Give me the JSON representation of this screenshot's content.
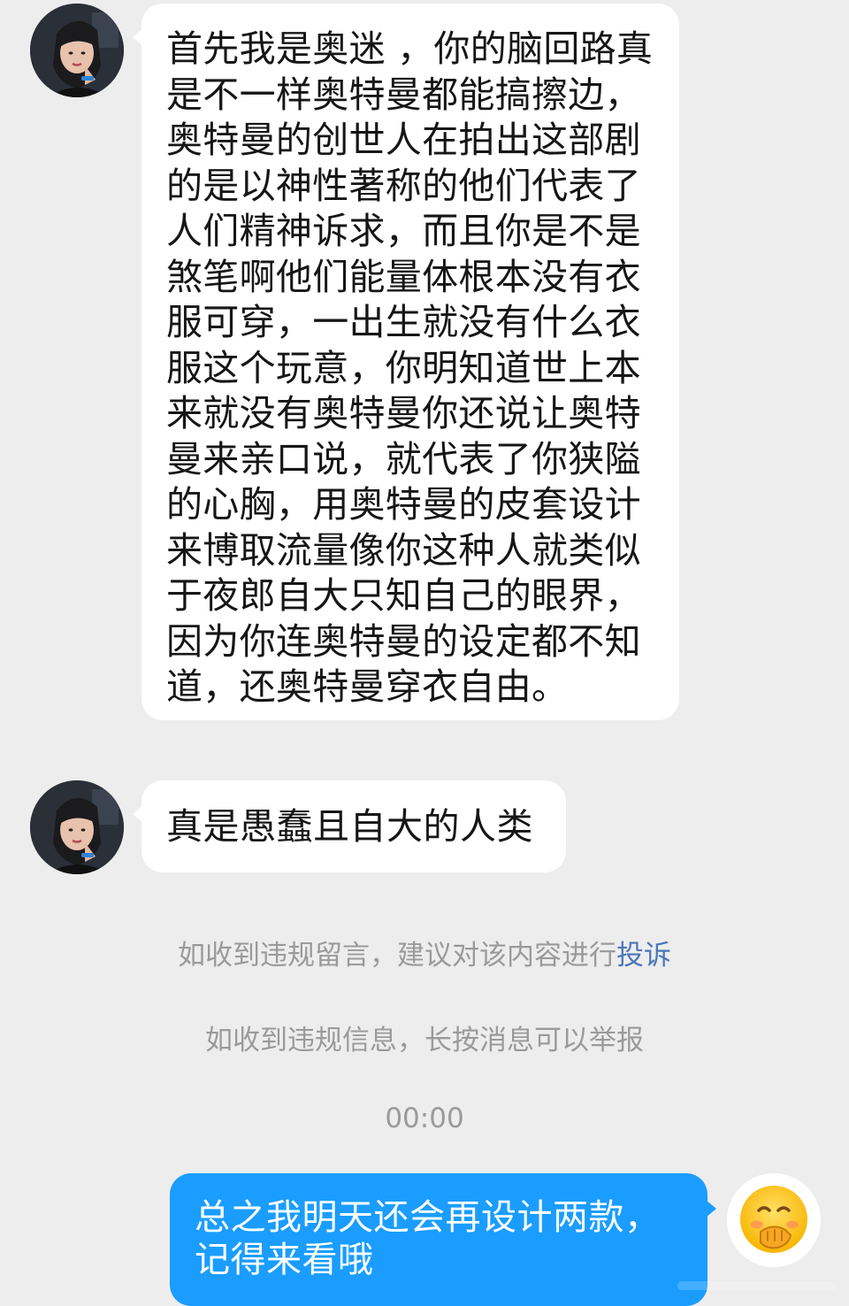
{
  "messages": [
    {
      "sender": "other",
      "text": "首先我是奥迷 ，你的脑回路真是不一样奥特曼都能搞擦边，奥特曼的创世人在拍出这部剧的是以神性著称的他们代表了人们精神诉求，而且你是不是煞笔啊他们能量体根本没有衣服可穿，一出生就没有什么衣服这个玩意，你明知道世上本来就没有奥特曼你还说让奥特曼来亲口说，就代表了你狭隘的心胸，用奥特曼的皮套设计来博取流量像你这种人就类似于夜郎自大只知自己的眼界，因为你连奥特曼的设定都不知道，还奥特曼穿衣自由。"
    },
    {
      "sender": "other",
      "text": "真是愚蠢且自大的人类"
    }
  ],
  "notices": {
    "complaint_prefix": "如收到违规留言，建议对该内容进行",
    "complaint_link": "投诉",
    "report": "如收到违规信息，长按消息可以举报"
  },
  "timestamp": "00:00",
  "outgoing": {
    "text": "总之我明天还会再设计两款，记得来看哦"
  },
  "colors": {
    "background": "#ededed",
    "incoming_bubble": "#ffffff",
    "outgoing_bubble": "#1a9dff",
    "link": "#4a77b8",
    "notice_text": "#9a9a9a"
  },
  "icons": {
    "other_avatar": "user-photo-avatar",
    "self_avatar": "face-with-hand-over-mouth-emoji"
  }
}
